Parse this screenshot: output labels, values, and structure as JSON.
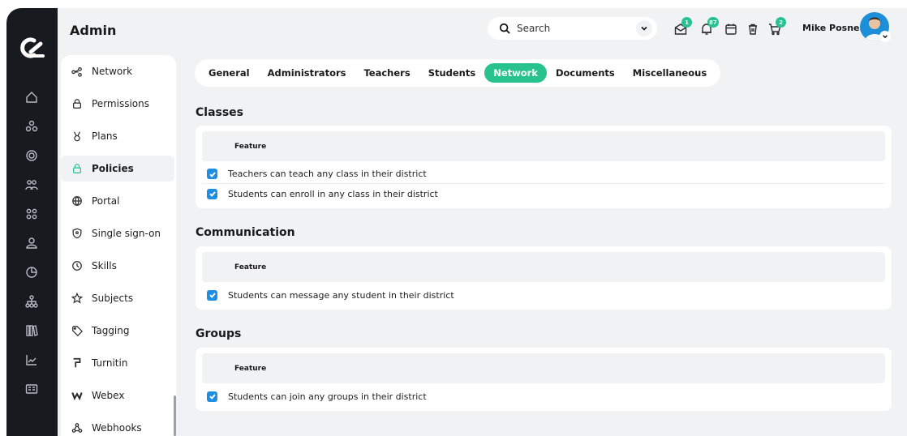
{
  "header": {
    "title": "Admin",
    "search_placeholder": "Search",
    "user_name": "Mike Posner",
    "badges": {
      "mail": "1",
      "bell": "87",
      "cart": "2"
    }
  },
  "rail": {
    "icons": [
      "home-icon",
      "modules-icon",
      "target-icon",
      "users-icon",
      "grid-icon",
      "user-icon",
      "pie-chart-icon",
      "hierarchy-icon",
      "library-icon",
      "trend-icon",
      "id-card-icon"
    ]
  },
  "sidebar": {
    "items": [
      {
        "label": "Network",
        "icon": "network-icon"
      },
      {
        "label": "Permissions",
        "icon": "lock-icon"
      },
      {
        "label": "Plans",
        "icon": "medal-icon"
      },
      {
        "label": "Policies",
        "icon": "lock-icon",
        "active": true
      },
      {
        "label": "Portal",
        "icon": "globe-icon"
      },
      {
        "label": "Single sign-on",
        "icon": "shield-icon"
      },
      {
        "label": "Skills",
        "icon": "clock-icon"
      },
      {
        "label": "Subjects",
        "icon": "star-icon"
      },
      {
        "label": "Tagging",
        "icon": "tag-icon"
      },
      {
        "label": "Turnitin",
        "icon": "turnitin-icon"
      },
      {
        "label": "Webex",
        "icon": "webex-icon"
      },
      {
        "label": "Webhooks",
        "icon": "webhook-icon"
      }
    ]
  },
  "tabs": [
    {
      "label": "General"
    },
    {
      "label": "Administrators"
    },
    {
      "label": "Teachers"
    },
    {
      "label": "Students"
    },
    {
      "label": "Network",
      "active": true
    },
    {
      "label": "Documents"
    },
    {
      "label": "Miscellaneous"
    }
  ],
  "sections": [
    {
      "title": "Classes",
      "header": "Feature",
      "rows": [
        {
          "label": "Teachers can teach any class in their district",
          "checked": true
        },
        {
          "label": "Students can enroll in any class in their district",
          "checked": true
        }
      ]
    },
    {
      "title": "Communication",
      "header": "Feature",
      "rows": [
        {
          "label": "Students can message any student in their district",
          "checked": true
        }
      ]
    },
    {
      "title": "Groups",
      "header": "Feature",
      "rows": [
        {
          "label": "Students can join any groups in their district",
          "checked": true
        }
      ]
    }
  ],
  "colors": {
    "accent": "#27c28d",
    "checkbox": "#1f8de0",
    "rail": "#171a1f",
    "app_bg": "#f1f2f4"
  }
}
